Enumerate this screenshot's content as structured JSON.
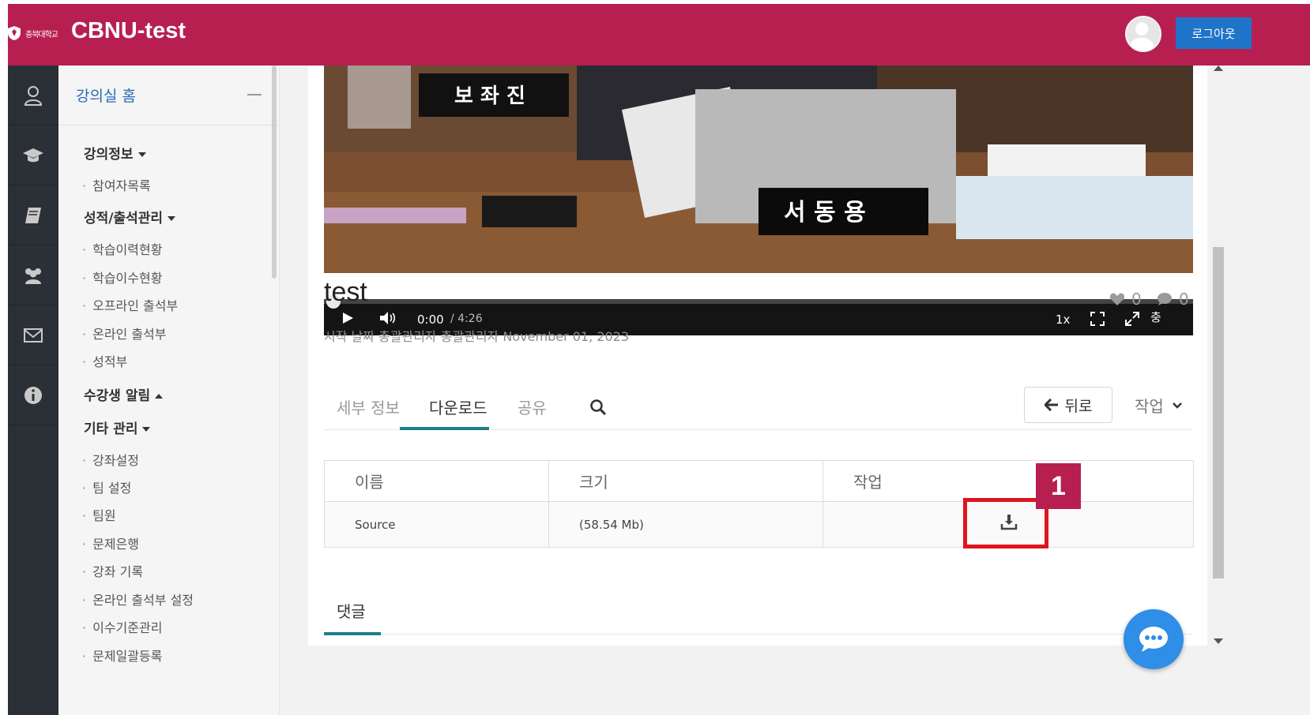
{
  "header": {
    "logo_text": "충북대학교",
    "site_title": "CBNU-test",
    "logout_label": "로그아웃"
  },
  "left_nav": {
    "home_label": "강의실 홈",
    "sections": [
      {
        "label": "강의정보"
      },
      {
        "label": "성적/출석관리"
      },
      {
        "label": "수강생 알림"
      },
      {
        "label": "기타 관리"
      }
    ],
    "items": {
      "participants": "참여자목록",
      "learning_history": "학습이력현황",
      "completion_status": "학습이수현황",
      "offline_attendance": "오프라인 출석부",
      "online_attendance": "온라인 출석부",
      "gradebook": "성적부",
      "course_settings": "강좌설정",
      "team_settings": "팀 설정",
      "team_members": "팀원",
      "question_bank": "문제은행",
      "course_records": "강좌 기록",
      "online_attendance_settings": "온라인 출석부 설정",
      "completion_criteria": "이수기준관리",
      "bulk_question_upload": "문제일괄등록"
    }
  },
  "video": {
    "nameplate_top": "보 좌 진",
    "nameplate_main": "서 동 용",
    "time_current": "0:00",
    "time_total": "/ 4:26",
    "speed": "1x",
    "broken_image_text": "충"
  },
  "media": {
    "title": "test",
    "meta": "시작 날짜 총괄관리자 총괄관리자 November 01, 2023",
    "likes": "0",
    "comments": "0"
  },
  "tabs": {
    "details": "세부 정보",
    "download": "다운로드",
    "share": "공유",
    "back": "뒤로",
    "actions": "작업"
  },
  "download_table": {
    "headers": [
      "이름",
      "크기",
      "작업"
    ],
    "rows": [
      {
        "name": "Source",
        "size": "(58.54 Mb)"
      }
    ]
  },
  "annotation": {
    "step": "1"
  },
  "comments": {
    "tab_label": "댓글"
  },
  "colors": {
    "brand": "#b71f51",
    "logout_blue": "#1f73c8",
    "tab_accent": "#1c7f8b",
    "highlight_red": "#e0131f",
    "chat_blue": "#2e8ee8"
  }
}
